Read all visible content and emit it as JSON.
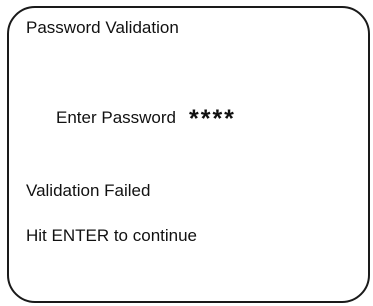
{
  "screen": {
    "title": "Password Validation",
    "password_label": "Enter Password",
    "password_mask": "****",
    "status": "Validation Failed",
    "instruction": "Hit ENTER to continue"
  },
  "colors": {
    "border": "#1a1a1a",
    "text": "#111111",
    "background": "#ffffff"
  }
}
